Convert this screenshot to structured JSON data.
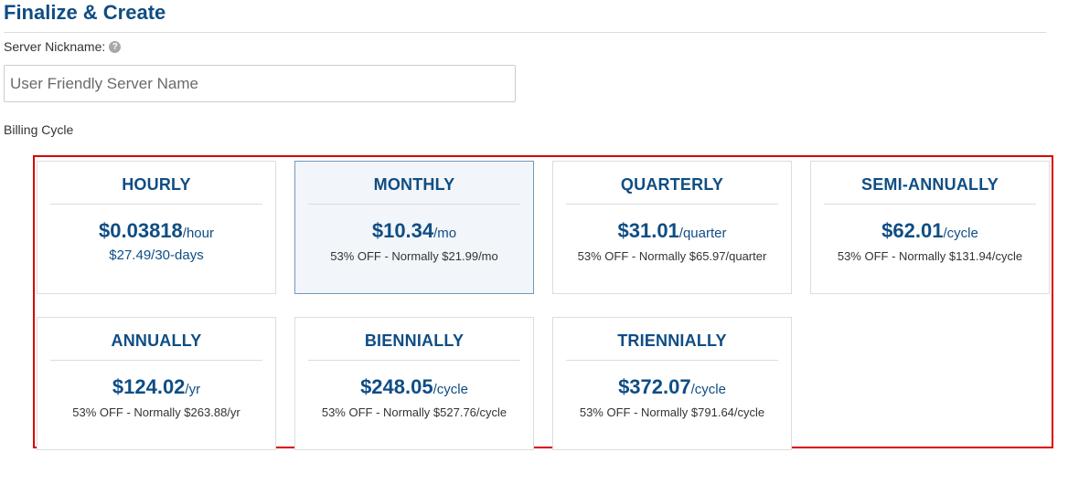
{
  "header": {
    "title": "Finalize & Create"
  },
  "nickname": {
    "label": "Server Nickname:",
    "help_icon": "question-circle",
    "placeholder": "User Friendly Server Name",
    "value": ""
  },
  "billing": {
    "label": "Billing Cycle",
    "highlight_color": "#d90000",
    "selected": "MONTHLY",
    "cycles": [
      {
        "name": "HOURLY",
        "price": "$0.03818",
        "unit": "/hour",
        "secondary": "$27.49/30-days"
      },
      {
        "name": "MONTHLY",
        "price": "$10.34",
        "unit": "/mo",
        "note": "53% OFF - Normally $21.99/mo"
      },
      {
        "name": "QUARTERLY",
        "price": "$31.01",
        "unit": "/quarter",
        "note": "53% OFF - Normally $65.97/quarter"
      },
      {
        "name": "SEMI-ANNUALLY",
        "price": "$62.01",
        "unit": "/cycle",
        "note": "53% OFF - Normally $131.94/cycle"
      },
      {
        "name": "ANNUALLY",
        "price": "$124.02",
        "unit": "/yr",
        "note": "53% OFF - Normally $263.88/yr"
      },
      {
        "name": "BIENNIALLY",
        "price": "$248.05",
        "unit": "/cycle",
        "note": "53% OFF - Normally $527.76/cycle"
      },
      {
        "name": "TRIENNIALLY",
        "price": "$372.07",
        "unit": "/cycle",
        "note": "53% OFF - Normally $791.64/cycle"
      }
    ]
  }
}
